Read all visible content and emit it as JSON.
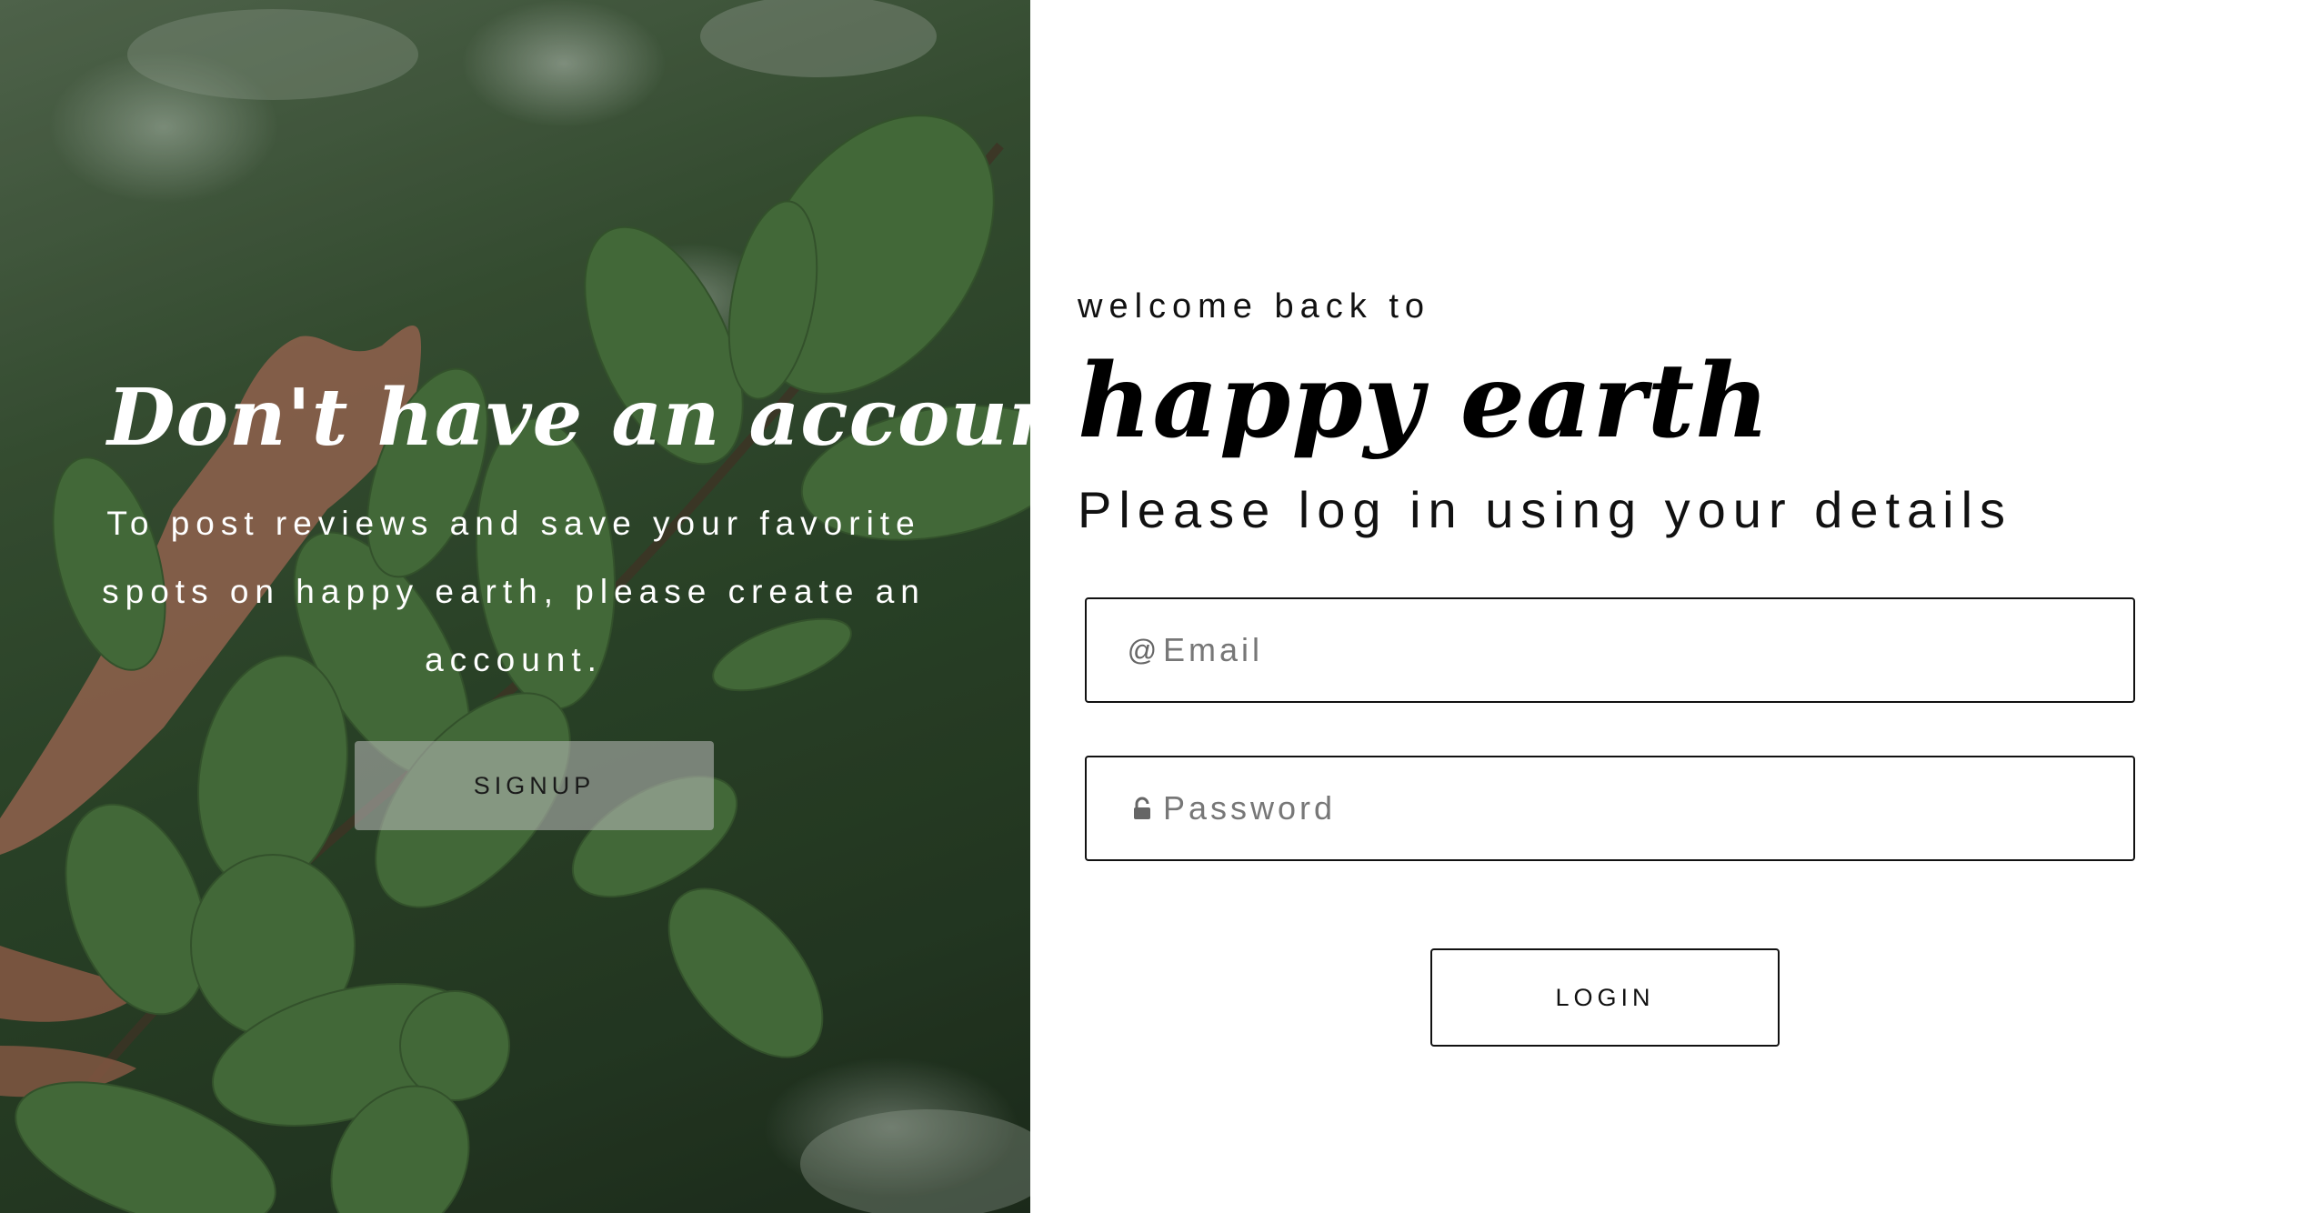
{
  "signup_panel": {
    "title": "Don't have an account?",
    "description": "To post reviews and save your favorite spots on happy earth, please create an account.",
    "signup_label": "SIGNUP"
  },
  "login_panel": {
    "welcome_text": "welcome back to",
    "brand_name": "happy earth",
    "instructions": "Please log in using your details",
    "email": {
      "placeholder": "Email",
      "value": "",
      "icon": "at-icon",
      "icon_glyph": "@"
    },
    "password": {
      "placeholder": "Password",
      "value": "",
      "icon": "lock-icon"
    },
    "login_label": "LOGIN"
  },
  "colors": {
    "panel_bg": "#ffffff",
    "text": "#111111",
    "signup_button_bg": "#bebebe",
    "leaf_green": "#4f7a43"
  }
}
